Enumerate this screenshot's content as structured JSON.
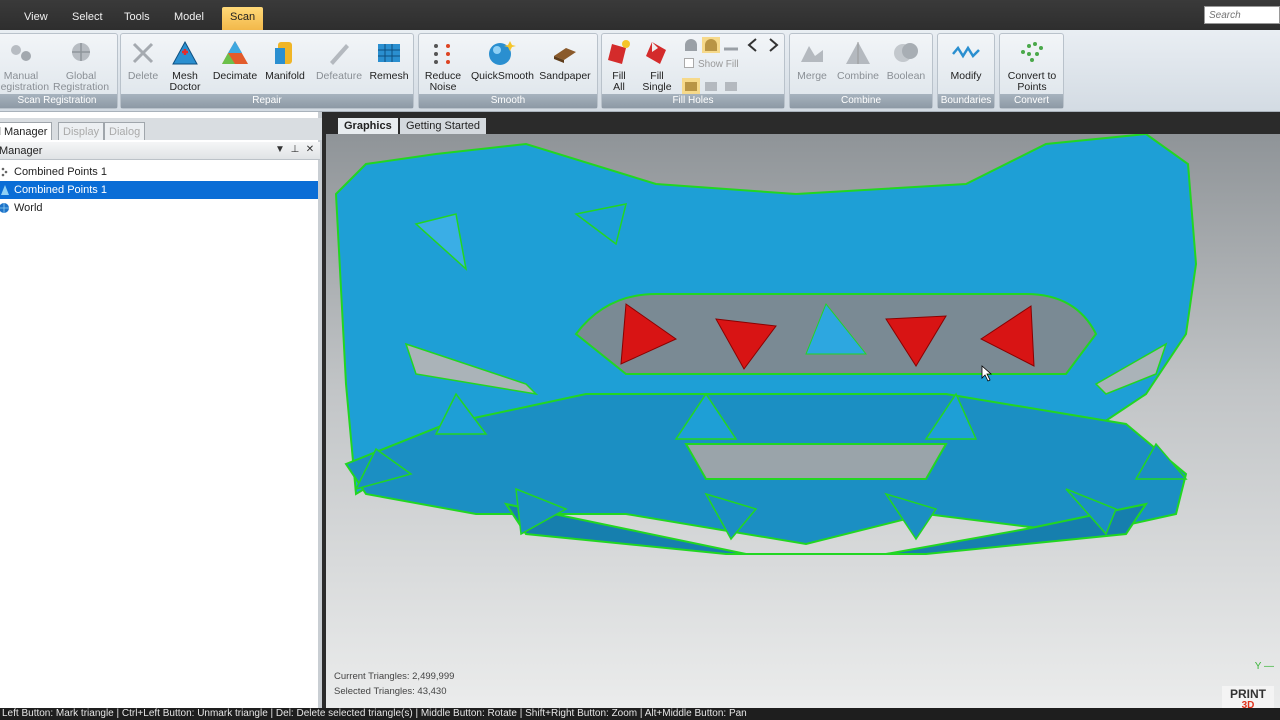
{
  "menu": {
    "items": [
      "View",
      "Select",
      "Tools",
      "Model",
      "Scan"
    ],
    "active": "Scan",
    "search_placeholder": "Search"
  },
  "ribbon": {
    "groups": {
      "scan_registration": "Scan Registration",
      "repair": "Repair",
      "smooth": "Smooth",
      "fill_holes": "Fill Holes",
      "combine": "Combine",
      "boundaries": "Boundaries",
      "convert": "Convert"
    },
    "tools": {
      "manual_registration": "Manual\nRegistration",
      "global_registration": "Global\nRegistration",
      "delete": "Delete",
      "mesh_doctor": "Mesh\nDoctor",
      "decimate": "Decimate",
      "manifold": "Manifold",
      "defeature": "Defeature",
      "remesh": "Remesh",
      "reduce_noise": "Reduce\nNoise",
      "quicksmooth": "QuickSmooth",
      "sandpaper": "Sandpaper",
      "fill_all": "Fill\nAll",
      "fill_single": "Fill\nSingle",
      "show_fill": "Show Fill",
      "merge": "Merge",
      "combine": "Combine",
      "boolean": "Boolean",
      "modify": "Modify",
      "convert_to_points": "Convert to\nPoints"
    }
  },
  "left_panel": {
    "tabs": [
      "Model Manager",
      "Display",
      "Dialog"
    ],
    "active_tab": "Model Manager",
    "header": "Model Manager",
    "tree": [
      {
        "label": "Combined Points 1",
        "selected": false
      },
      {
        "label": "Combined Points 1",
        "selected": true
      },
      {
        "label": "World",
        "selected": false
      }
    ]
  },
  "viewport": {
    "tabs": [
      "Graphics",
      "Getting Started"
    ],
    "active_tab": "Graphics",
    "current_triangles": "Current Triangles: 2,499,999",
    "selected_triangles": "Selected Triangles: 43,430",
    "axis_label": "Y",
    "brand_top": "PRINT",
    "brand_bottom": "3D"
  },
  "status_bar": "Left Button: Mark triangle | Ctrl+Left Button: Unmark triangle | Del: Delete selected triangle(s) | Middle Button: Rotate | Shift+Right Button: Zoom | Alt+Middle Button: Pan",
  "colors": {
    "mesh": "#1e9fd6",
    "mesh_dark": "#0f6f9e",
    "boundary": "#22d622",
    "selected_triangle": "#d81414",
    "active_tab": "#f2b84a",
    "selection": "#0a6dd6"
  }
}
